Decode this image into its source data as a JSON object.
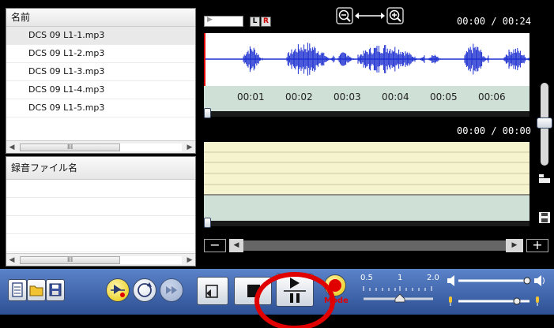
{
  "file_list": {
    "header": "名前",
    "files": [
      "DCS 09 L1-1.mp3",
      "DCS 09 L1-2.mp3",
      "DCS 09 L1-3.mp3",
      "DCS 09 L1-4.mp3",
      "DCS 09 L1-5.mp3"
    ],
    "scroll_thumb": "III"
  },
  "recording_list": {
    "header": "録音ファイル名",
    "scroll_thumb": "III"
  },
  "player": {
    "channel_l": "L",
    "channel_r": "R",
    "time_top": "00:00 / 00:24",
    "time_bottom": "00:00 / 00:00",
    "ruler_ticks": [
      "00:01",
      "00:02",
      "00:03",
      "00:04",
      "00:05",
      "00:06"
    ]
  },
  "speed": {
    "labels": [
      "0.5",
      "1",
      "2.0"
    ],
    "value": 1.0
  },
  "mode_label": "Mode",
  "colors": {
    "waveform": "#1c2fd0",
    "ruler": "#cfe0d6",
    "cream": "#f6f3cf",
    "toolbar": "#3f64a8",
    "record": "#e00000",
    "annotation_circle": "#e00000"
  }
}
